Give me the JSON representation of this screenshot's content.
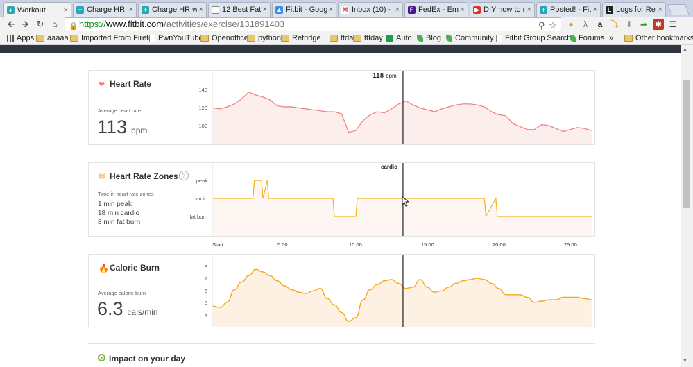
{
  "browser": {
    "tabs": [
      {
        "label": "Workout",
        "fav": "fitbit"
      },
      {
        "label": "Charge HR - F",
        "fav": "fitbit"
      },
      {
        "label": "Charge HR wi",
        "fav": "fitbit"
      },
      {
        "label": "12 Best Fat Bu",
        "fav": "page"
      },
      {
        "label": "Fitbit - Google",
        "fav": "drive"
      },
      {
        "label": "Inbox (10) - rl",
        "fav": "gmail"
      },
      {
        "label": "FedEx - Email",
        "fav": "fedex"
      },
      {
        "label": "DIY how to m",
        "fav": "youtube"
      },
      {
        "label": "Posted! - Fitbi",
        "fav": "fitbit"
      },
      {
        "label": "Logs for Recip",
        "fav": "logs"
      }
    ],
    "url": {
      "scheme": "https://",
      "host": "www.fitbit.com",
      "path": "/activities/exercise/131891403"
    },
    "bookmarks": [
      {
        "label": "Apps",
        "icon": "apps"
      },
      {
        "label": "aaaaa",
        "icon": "folder"
      },
      {
        "label": "Imported From Firefc",
        "icon": "folder"
      },
      {
        "label": "PwnYouTube",
        "icon": "page"
      },
      {
        "label": "Openoffice",
        "icon": "folder"
      },
      {
        "label": "python",
        "icon": "folder"
      },
      {
        "label": "Refridge",
        "icon": "folder"
      },
      {
        "label": "ttday",
        "icon": "folder"
      },
      {
        "label": "tttday",
        "icon": "folder"
      },
      {
        "label": "Auto",
        "icon": "sheet"
      },
      {
        "label": "Blog",
        "icon": "leaf"
      },
      {
        "label": "Community",
        "icon": "leaf"
      },
      {
        "label": "Fitbit Group Search -",
        "icon": "page"
      },
      {
        "label": "Forums",
        "icon": "leaf"
      }
    ],
    "overflow": "»",
    "other_bookmarks": "Other bookmarks"
  },
  "heart_rate": {
    "title": "Heart Rate",
    "sublabel": "Average heart rate",
    "value": "113",
    "unit": "bpm",
    "cursor_value": "118",
    "cursor_unit": "bpm",
    "yticks": [
      "140",
      "120",
      "100"
    ],
    "color": "#f07a7a"
  },
  "zones": {
    "title": "Heart Rate Zones",
    "help": "?",
    "sublabel": "Time in heart rate zones",
    "lines": [
      "1 min peak",
      "18 min cardio",
      "8 min fat burn"
    ],
    "levels": [
      "peak",
      "cardio",
      "fat burn"
    ],
    "cursor_label": "cardio",
    "color": "#f2b51c"
  },
  "xaxis": [
    "Start",
    "5:00",
    "10:00",
    "15:00",
    "20:00",
    "25:00"
  ],
  "calories": {
    "title": "Calorie Burn",
    "sublabel": "Average calorie burn",
    "value": "6.3",
    "unit": "cals/min",
    "yticks": [
      "8",
      "7",
      "6",
      "5",
      "4"
    ],
    "color": "#f5a623"
  },
  "impact": {
    "title": "Impact on your day"
  },
  "chart_data": [
    {
      "type": "line",
      "title": "Heart Rate",
      "ylabel": "bpm",
      "ylim": [
        90,
        145
      ],
      "x": [
        0,
        0.5,
        1,
        1.5,
        2,
        2.5,
        3,
        3.5,
        4,
        4.5,
        5,
        5.5,
        6,
        6.5,
        7,
        7.5,
        8,
        8.5,
        9,
        9.5,
        10,
        10.5,
        11,
        11.5,
        12,
        12.5,
        13,
        13.5,
        14,
        14.5,
        15,
        15.5,
        16,
        16.5,
        17,
        17.5,
        18,
        18.5,
        19,
        19.5,
        20,
        20.5,
        21,
        21.5,
        22,
        22.5,
        23,
        23.5,
        24,
        24.5,
        25,
        25.5,
        26,
        26.5
      ],
      "values": [
        120,
        119,
        121,
        124,
        129,
        136,
        133,
        131,
        128,
        122,
        121,
        121,
        120,
        119,
        118,
        117,
        116,
        116,
        114,
        95,
        97,
        107,
        113,
        116,
        115,
        119,
        124,
        127,
        123,
        120,
        118,
        116,
        119,
        121,
        123,
        124,
        124,
        123,
        121,
        116,
        113,
        112,
        104,
        101,
        98,
        98,
        103,
        102,
        99,
        96,
        98,
        100,
        99,
        97,
        98,
        103
      ]
    },
    {
      "type": "line",
      "title": "Heart Rate Zones",
      "levels": [
        "fat burn",
        "cardio",
        "peak"
      ],
      "x": [
        0,
        2.8,
        2.9,
        3.4,
        3.5,
        3.8,
        3.9,
        8.4,
        8.5,
        10.0,
        10.1,
        19.0,
        19.1,
        19.8,
        19.9,
        26.5
      ],
      "values": [
        "cardio",
        "cardio",
        "peak",
        "peak",
        "cardio",
        "peak",
        "cardio",
        "cardio",
        "fat burn",
        "fat burn",
        "cardio",
        "cardio",
        "fat burn",
        "cardio",
        "fat burn",
        "fat burn"
      ]
    },
    {
      "type": "area",
      "title": "Calorie Burn",
      "ylabel": "cals/min",
      "ylim": [
        3.8,
        8.4
      ],
      "x": [
        0,
        0.5,
        1,
        1.5,
        2,
        2.5,
        3,
        3.5,
        4,
        4.5,
        5,
        5.5,
        6,
        6.5,
        7,
        7.5,
        8,
        8.5,
        9,
        9.5,
        10,
        10.5,
        11,
        11.5,
        12,
        12.5,
        13,
        13.5,
        14,
        14.5,
        15,
        15.5,
        16,
        16.5,
        17,
        17.5,
        18,
        18.5,
        19,
        19.5,
        20,
        20.5,
        21,
        21.5,
        22,
        22.5,
        23,
        23.5,
        24,
        24.5,
        25,
        25.5,
        26,
        26.5
      ],
      "values": [
        5.1,
        5,
        5.4,
        6.4,
        7,
        7.5,
        8,
        7.8,
        7.5,
        7.1,
        6.7,
        6.4,
        6.2,
        6.1,
        6.3,
        6.5,
        5.7,
        5.2,
        4.6,
        3.9,
        4.2,
        5.6,
        6.4,
        6.8,
        7.1,
        7.2,
        6.9,
        6.5,
        6.6,
        7.2,
        6.6,
        6.2,
        6.3,
        6.6,
        6.9,
        7.1,
        7.2,
        7.3,
        7.2,
        6.9,
        6.5,
        6,
        6,
        6,
        5.8,
        5.4,
        5.5,
        5.6,
        5.6,
        5.8,
        5.8,
        5.8,
        5.7,
        5.6
      ]
    }
  ]
}
